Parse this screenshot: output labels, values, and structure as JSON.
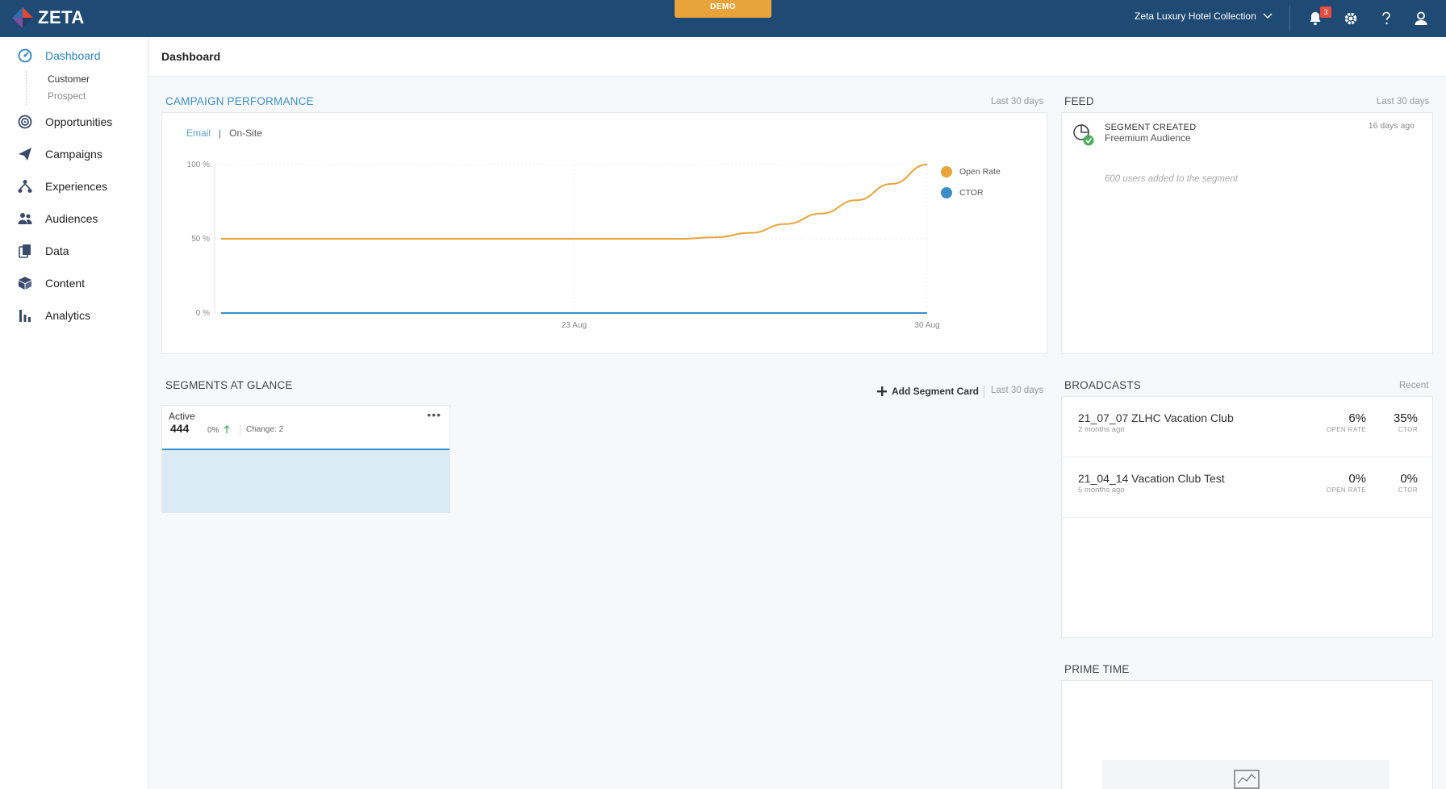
{
  "topbar": {
    "brand": "ZETA",
    "demo_label": "DEMO",
    "org_name": "Zeta Luxury Hotel Collection",
    "notification_count": "3"
  },
  "sidebar": {
    "items": [
      {
        "label": "Dashboard",
        "icon": "dashboard-icon"
      },
      {
        "label": "Opportunities",
        "icon": "target-icon"
      },
      {
        "label": "Campaigns",
        "icon": "paper-plane-icon"
      },
      {
        "label": "Experiences",
        "icon": "sitemap-icon"
      },
      {
        "label": "Audiences",
        "icon": "users-icon"
      },
      {
        "label": "Data",
        "icon": "database-icon"
      },
      {
        "label": "Content",
        "icon": "box-icon"
      },
      {
        "label": "Analytics",
        "icon": "bar-chart-icon"
      }
    ],
    "sub_items": [
      "Customer",
      "Prospect"
    ]
  },
  "page": {
    "title": "Dashboard"
  },
  "campaign_performance": {
    "title": "CAMPAIGN PERFORMANCE",
    "range": "Last 30 days",
    "tabs": [
      "Email",
      "On-Site"
    ],
    "separator": "|"
  },
  "chart_data": {
    "type": "line",
    "x_ticks": [
      "23 Aug",
      "30 Aug"
    ],
    "y_ticks": [
      "100 %",
      "50 %",
      "0 %"
    ],
    "ylim": [
      0,
      100
    ],
    "x_index": [
      0,
      1,
      2,
      3,
      4,
      5,
      6,
      7,
      8,
      9,
      10,
      11,
      12,
      13,
      14,
      15,
      16,
      17,
      18,
      19,
      20
    ],
    "series": [
      {
        "name": "Open Rate",
        "color": "#e8a43a",
        "values": [
          50,
          50,
          50,
          50,
          50,
          50,
          50,
          50,
          50,
          50,
          50,
          50,
          50,
          50,
          51,
          54,
          60,
          67,
          76,
          87,
          100
        ]
      },
      {
        "name": "CTOR",
        "color": "#3a8fc8",
        "values": [
          0,
          0,
          0,
          0,
          0,
          0,
          0,
          0,
          0,
          0,
          0,
          0,
          0,
          0,
          0,
          0,
          0,
          0,
          0,
          0,
          0
        ]
      }
    ],
    "grid": true,
    "legend_position": "right"
  },
  "feed": {
    "title": "FEED",
    "range": "Last 30 days",
    "entry": {
      "title": "SEGMENT CREATED",
      "subtitle": "Freemium Audience",
      "time": "16 days ago",
      "note": "600 users added to the segment"
    }
  },
  "segments": {
    "title": "SEGMENTS AT GLANCE",
    "add_label": "Add Segment Card",
    "range": "Last 30 days",
    "card": {
      "label": "Active",
      "value": "444",
      "pct": "0%",
      "change": "Change: 2",
      "menu": "•••"
    }
  },
  "broadcasts": {
    "title": "BROADCASTS",
    "range": "Recent",
    "open_rate_label": "OPEN RATE",
    "ctor_label": "CTOR",
    "rows": [
      {
        "name": "21_07_07 ZLHC Vacation Club",
        "age": "2 months ago",
        "open_rate": "6%",
        "ctor": "35%"
      },
      {
        "name": "21_04_14 Vacation Club Test",
        "age": "5 months ago",
        "open_rate": "0%",
        "ctor": "0%"
      }
    ]
  },
  "prime_time": {
    "title": "PRIME TIME"
  }
}
